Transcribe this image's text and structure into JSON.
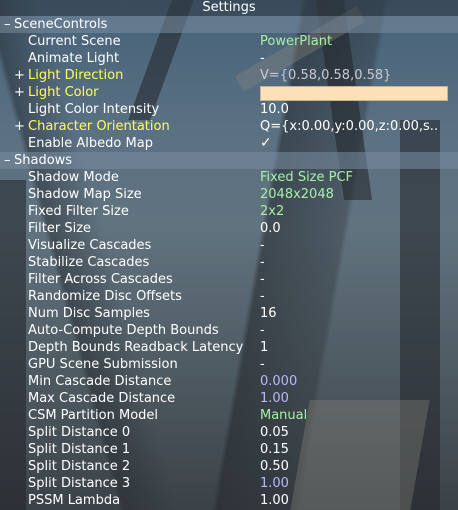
{
  "title": "Settings",
  "colors": {
    "label": "#ffffff",
    "highlight_label": "#ffff55",
    "string_value": "#a6f0a6",
    "edited_value": "#b8b8ff",
    "light_color_swatch": "#fbe0b8"
  },
  "scene_controls": {
    "header": "SceneControls",
    "toggle": "–",
    "rows": [
      {
        "label": "Current Scene",
        "value": "PowerPlant",
        "expander": "",
        "kind": "string"
      },
      {
        "label": "Animate Light",
        "value": "-",
        "expander": "",
        "kind": "plain"
      },
      {
        "label": "Light Direction",
        "value": "V={0.58,0.58,0.58}",
        "expander": "+",
        "kind": "dim",
        "highlight": true
      },
      {
        "label": "Light Color",
        "value": "",
        "expander": "+",
        "kind": "swatch",
        "highlight": true
      },
      {
        "label": "Light Color Intensity",
        "value": "10.0",
        "expander": "",
        "kind": "plain"
      },
      {
        "label": "Character Orientation",
        "value": "Q={x:0.00,y:0.00,z:0.00,s..",
        "expander": "+",
        "kind": "plain",
        "highlight": true
      },
      {
        "label": "Enable Albedo Map",
        "value": "✓",
        "expander": "",
        "kind": "check"
      }
    ]
  },
  "shadows": {
    "header": "Shadows",
    "toggle": "–",
    "rows": [
      {
        "label": "Shadow Mode",
        "value": "Fixed Size PCF",
        "kind": "string"
      },
      {
        "label": "Shadow Map Size",
        "value": "2048x2048",
        "kind": "string"
      },
      {
        "label": "Fixed Filter Size",
        "value": "2x2",
        "kind": "string"
      },
      {
        "label": "Filter Size",
        "value": "0.0",
        "kind": "plain"
      },
      {
        "label": "Visualize Cascades",
        "value": "-",
        "kind": "plain"
      },
      {
        "label": "Stabilize Cascades",
        "value": "-",
        "kind": "plain"
      },
      {
        "label": "Filter Across Cascades",
        "value": "-",
        "kind": "plain"
      },
      {
        "label": "Randomize Disc Offsets",
        "value": "-",
        "kind": "plain"
      },
      {
        "label": "Num Disc Samples",
        "value": "16",
        "kind": "plain"
      },
      {
        "label": "Auto-Compute Depth Bounds",
        "value": "-",
        "kind": "plain"
      },
      {
        "label": "Depth Bounds Readback Latency",
        "value": "1",
        "kind": "plain"
      },
      {
        "label": "GPU Scene Submission",
        "value": "-",
        "kind": "plain"
      },
      {
        "label": "Min Cascade Distance",
        "value": "0.000",
        "kind": "edited"
      },
      {
        "label": "Max Cascade Distance",
        "value": "1.00",
        "kind": "edited"
      },
      {
        "label": "CSM Partition Model",
        "value": "Manual",
        "kind": "string"
      },
      {
        "label": "Split Distance 0",
        "value": "0.05",
        "kind": "plain"
      },
      {
        "label": "Split Distance 1",
        "value": "0.15",
        "kind": "plain"
      },
      {
        "label": "Split Distance 2",
        "value": "0.50",
        "kind": "plain"
      },
      {
        "label": "Split Distance 3",
        "value": "1.00",
        "kind": "edited"
      },
      {
        "label": "PSSM Lambda",
        "value": "1.00",
        "kind": "plain"
      }
    ]
  }
}
